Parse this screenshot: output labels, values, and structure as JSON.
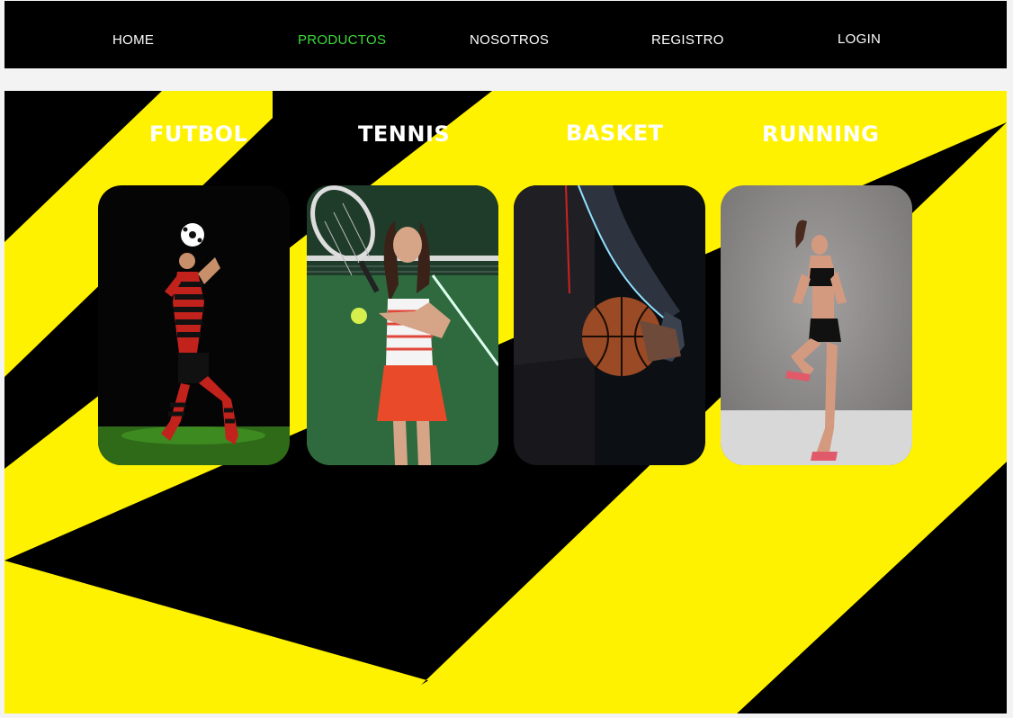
{
  "nav": {
    "items": [
      {
        "label": "HOME",
        "active": false
      },
      {
        "label": "PRODUCTOS",
        "active": true
      },
      {
        "label": "NOSOTROS",
        "active": false
      },
      {
        "label": "REGISTRO",
        "active": false
      },
      {
        "label": "LOGIN",
        "active": false
      }
    ],
    "active_color": "#3ddc3a"
  },
  "hero": {
    "colors": {
      "background": "#000000",
      "stripe": "#fff200"
    },
    "categories": [
      {
        "title": "FUTBOL",
        "image": "soccer-player-heading-ball-photo"
      },
      {
        "title": "TENNIS",
        "image": "tennis-player-with-racket-photo"
      },
      {
        "title": "BASKET",
        "image": "basketball-player-holding-ball-photo"
      },
      {
        "title": "RUNNING",
        "image": "runner-athlete-knee-raise-photo"
      }
    ]
  }
}
